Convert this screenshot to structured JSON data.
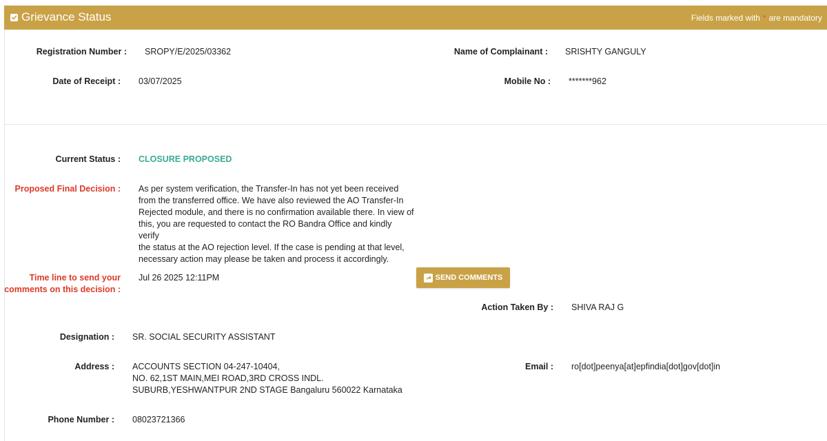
{
  "header": {
    "title": "Grievance Status",
    "mandatory_prefix": "Fields marked with",
    "mandatory_star": "*",
    "mandatory_suffix": "are mandatory"
  },
  "fields": {
    "registration_number": {
      "label": "Registration Number :",
      "value": "SROPY/E/2025/03362"
    },
    "complainant_name": {
      "label": "Name of Complainant :",
      "value": "SRISHTY GANGULY"
    },
    "date_of_receipt": {
      "label": "Date of Receipt :",
      "value": "03/07/2025"
    },
    "mobile_no": {
      "label": "Mobile No :",
      "value": "*******962"
    },
    "current_status": {
      "label": "Current Status :",
      "value": "CLOSURE PROPOSED"
    },
    "proposed_final_decision": {
      "label": "Proposed Final Decision :",
      "value": "As per system verification, the Transfer-In has not yet been received\nfrom the transferred office. We have also reviewed the AO Transfer-In\nRejected module, and there is no confirmation available there. In view of\nthis, you are requested to contact the RO Bandra Office and kindly verify\nthe status at the AO rejection level. If the case is pending at that level,\nnecessary action may please be taken and process it accordingly."
    },
    "timeline": {
      "label": "Time line to send your\ncomments on this decision :",
      "value": "Jul 26 2025 12:11PM"
    },
    "action_taken_by": {
      "label": "Action Taken By :",
      "value": "SHIVA RAJ G"
    },
    "designation": {
      "label": "Designation :",
      "value": "SR. SOCIAL SECURITY ASSISTANT"
    },
    "address": {
      "label": "Address :",
      "value": "ACCOUNTS SECTION 04-247-10404,\nNO. 62,1ST MAIN,MEI ROAD,3RD CROSS INDL.\nSUBURB,YESHWANTPUR 2ND STAGE Bangaluru 560022 Karnataka"
    },
    "email": {
      "label": "Email :",
      "value": "ro[dot]peenya[at]epfindia[dot]gov[dot]in"
    },
    "phone_number": {
      "label": "Phone Number :",
      "value": "08023721366"
    }
  },
  "actions": {
    "send_comments_label": "SEND COMMENTS"
  },
  "colors": {
    "header_bg": "#c9a247",
    "status_green": "#3caa95",
    "label_red": "#dc3a28"
  },
  "icons": {
    "header_checkbox": "checkbox-icon",
    "send_comments": "share-icon"
  }
}
